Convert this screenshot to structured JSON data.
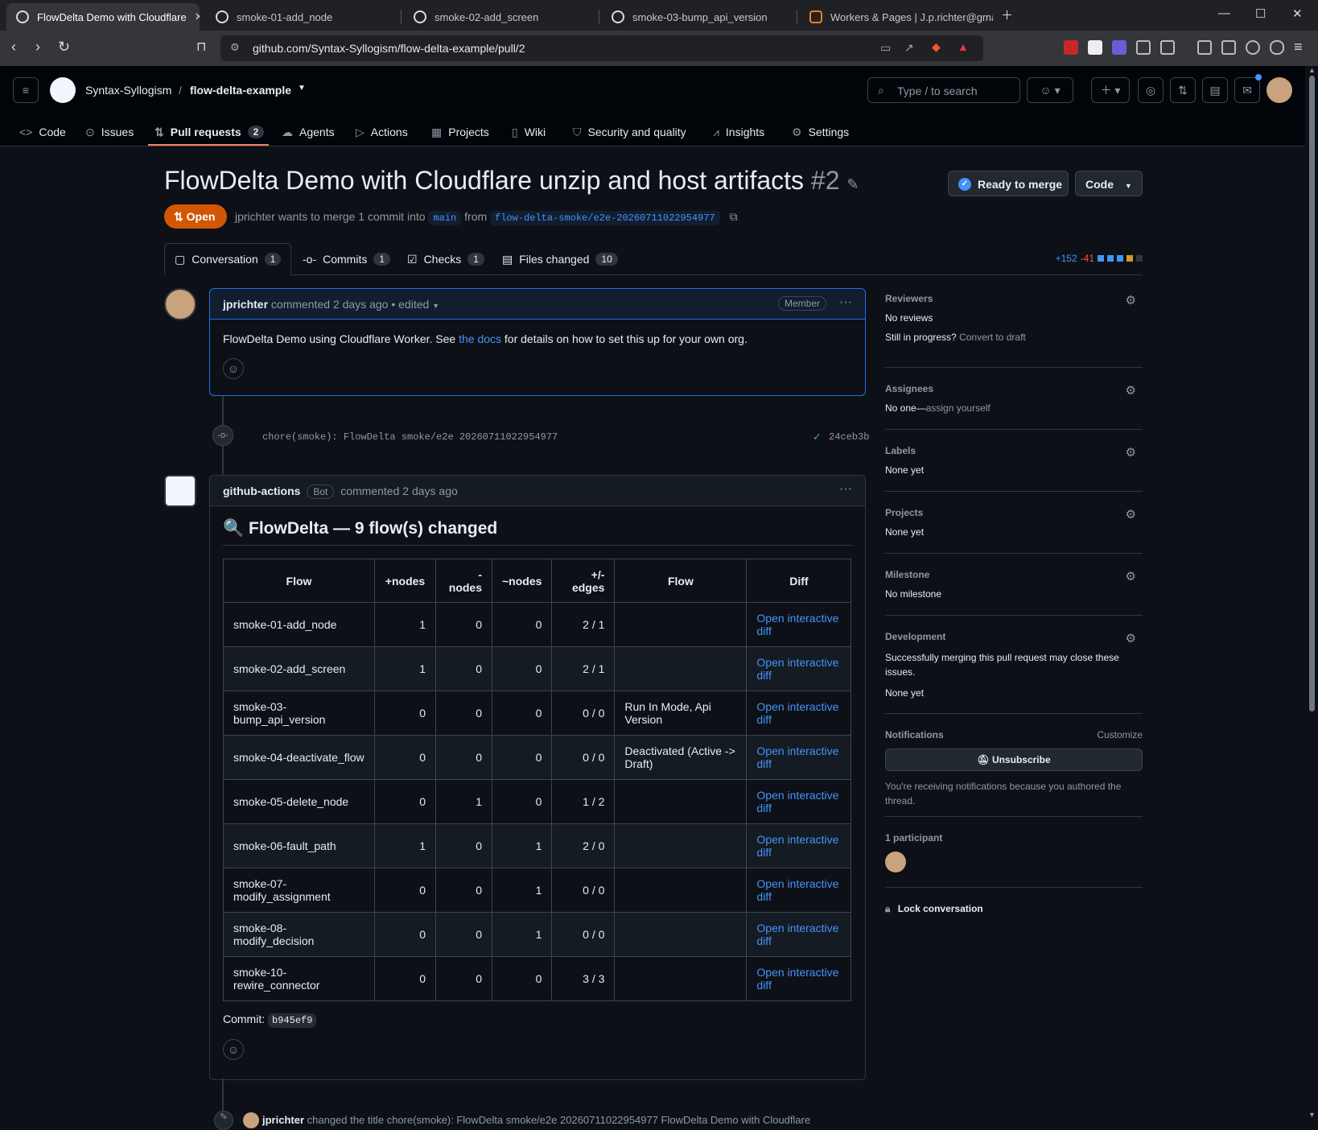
{
  "browser": {
    "tabs": [
      {
        "label": "FlowDelta Demo with Cloudflare",
        "active": true
      },
      {
        "label": "smoke-01-add_node"
      },
      {
        "label": "smoke-02-add_screen"
      },
      {
        "label": "smoke-03-bump_api_version"
      },
      {
        "label": "Workers & Pages | J.p.richter@gmail.c"
      }
    ],
    "url": "github.com/Syntax-Syllogism/flow-delta-example/pull/2"
  },
  "header": {
    "owner": "Syntax-Syllogism",
    "separator": "/",
    "repo": "flow-delta-example",
    "search_placeholder": "Type / to search",
    "nav": [
      {
        "label": "Code"
      },
      {
        "label": "Issues"
      },
      {
        "label": "Pull requests",
        "count": "2"
      },
      {
        "label": "Agents"
      },
      {
        "label": "Actions"
      },
      {
        "label": "Projects"
      },
      {
        "label": "Wiki"
      },
      {
        "label": "Security and quality"
      },
      {
        "label": "Insights"
      },
      {
        "label": "Settings"
      }
    ]
  },
  "pr": {
    "title": "FlowDelta Demo with Cloudflare unzip and host artifacts",
    "number": "#2",
    "ready_label": "Ready to merge",
    "code_label": "Code",
    "state": "Open",
    "author": "jprichter",
    "merge_text": "wants to merge 1 commit into",
    "base": "main",
    "from_text": "from",
    "head": "flow-delta-smoke/e2e-20260711022954977",
    "tabs": [
      {
        "label": "Conversation",
        "count": "1"
      },
      {
        "label": "Commits",
        "count": "1"
      },
      {
        "label": "Checks",
        "count": "1"
      },
      {
        "label": "Files changed",
        "count": "10"
      }
    ],
    "additions": "+152",
    "deletions": "-41"
  },
  "comment1": {
    "author": "jprichter",
    "action": "commented",
    "time": "2 days ago",
    "edited": "• edited",
    "badge": "Member",
    "body_pre": "FlowDelta Demo using Cloudflare Worker. See",
    "body_link": "the docs",
    "body_post": "for details on how to set this up for your own org."
  },
  "commit": {
    "message": "chore(smoke): FlowDelta smoke/e2e 20260711022954977",
    "sha": "24ceb3b"
  },
  "comment2": {
    "author": "github-actions",
    "bot": "Bot",
    "action": "commented",
    "time": "2 days ago",
    "heading": "FlowDelta — 9 flow(s) changed",
    "columns": [
      "Flow",
      "+nodes",
      "-\nnodes",
      "~nodes",
      "+/-\nedges",
      "Flow",
      "Diff"
    ],
    "rows": [
      {
        "flow": "smoke-01-add_node",
        "plus": "1",
        "minus": "0",
        "tilde": "0",
        "edges": "2 / 1",
        "change": "",
        "diff": "Open interactive diff"
      },
      {
        "flow": "smoke-02-add_screen",
        "plus": "1",
        "minus": "0",
        "tilde": "0",
        "edges": "2 / 1",
        "change": "",
        "diff": "Open interactive diff"
      },
      {
        "flow": "smoke-03-bump_api_version",
        "plus": "0",
        "minus": "0",
        "tilde": "0",
        "edges": "0 / 0",
        "change": "Run In Mode, Api Version",
        "diff": "Open interactive diff"
      },
      {
        "flow": "smoke-04-deactivate_flow",
        "plus": "0",
        "minus": "0",
        "tilde": "0",
        "edges": "0 / 0",
        "change": "Deactivated (Active -> Draft)",
        "diff": "Open interactive diff"
      },
      {
        "flow": "smoke-05-delete_node",
        "plus": "0",
        "minus": "1",
        "tilde": "0",
        "edges": "1 / 2",
        "change": "",
        "diff": "Open interactive diff"
      },
      {
        "flow": "smoke-06-fault_path",
        "plus": "1",
        "minus": "0",
        "tilde": "1",
        "edges": "2 / 0",
        "change": "",
        "diff": "Open interactive diff"
      },
      {
        "flow": "smoke-07-modify_assignment",
        "plus": "0",
        "minus": "0",
        "tilde": "1",
        "edges": "0 / 0",
        "change": "",
        "diff": "Open interactive diff"
      },
      {
        "flow": "smoke-08-modify_decision",
        "plus": "0",
        "minus": "0",
        "tilde": "1",
        "edges": "0 / 0",
        "change": "",
        "diff": "Open interactive diff"
      },
      {
        "flow": "smoke-10-rewire_connector",
        "plus": "0",
        "minus": "0",
        "tilde": "0",
        "edges": "3 / 3",
        "change": "",
        "diff": "Open interactive diff"
      }
    ],
    "commit_label": "Commit:",
    "commit_sha": "b945ef9"
  },
  "event": {
    "author": "jprichter",
    "text": "changed the title chore(smoke): FlowDelta smoke/e2e 20260711022954977 FlowDelta Demo with Cloudflare"
  },
  "sidebar": {
    "reviewers": {
      "heading": "Reviewers",
      "value": "No reviews",
      "progress": "Still in progress?",
      "draft_link": "Convert to draft"
    },
    "assignees": {
      "heading": "Assignees",
      "value": "No one—",
      "link": "assign yourself"
    },
    "labels": {
      "heading": "Labels",
      "value": "None yet"
    },
    "projects": {
      "heading": "Projects",
      "value": "None yet"
    },
    "milestone": {
      "heading": "Milestone",
      "value": "No milestone"
    },
    "development": {
      "heading": "Development",
      "text": "Successfully merging this pull request may close these issues.",
      "value": "None yet"
    },
    "notifications": {
      "heading": "Notifications",
      "customize": "Customize",
      "button": "Unsubscribe",
      "note": "You're receiving notifications because you authored the thread."
    },
    "participants": {
      "heading": "1 participant"
    },
    "lock": "Lock conversation"
  },
  "colors": {
    "accent": "#4493f8",
    "open": "#d15704",
    "underline": "#f78166",
    "bg": "#0d1117"
  }
}
